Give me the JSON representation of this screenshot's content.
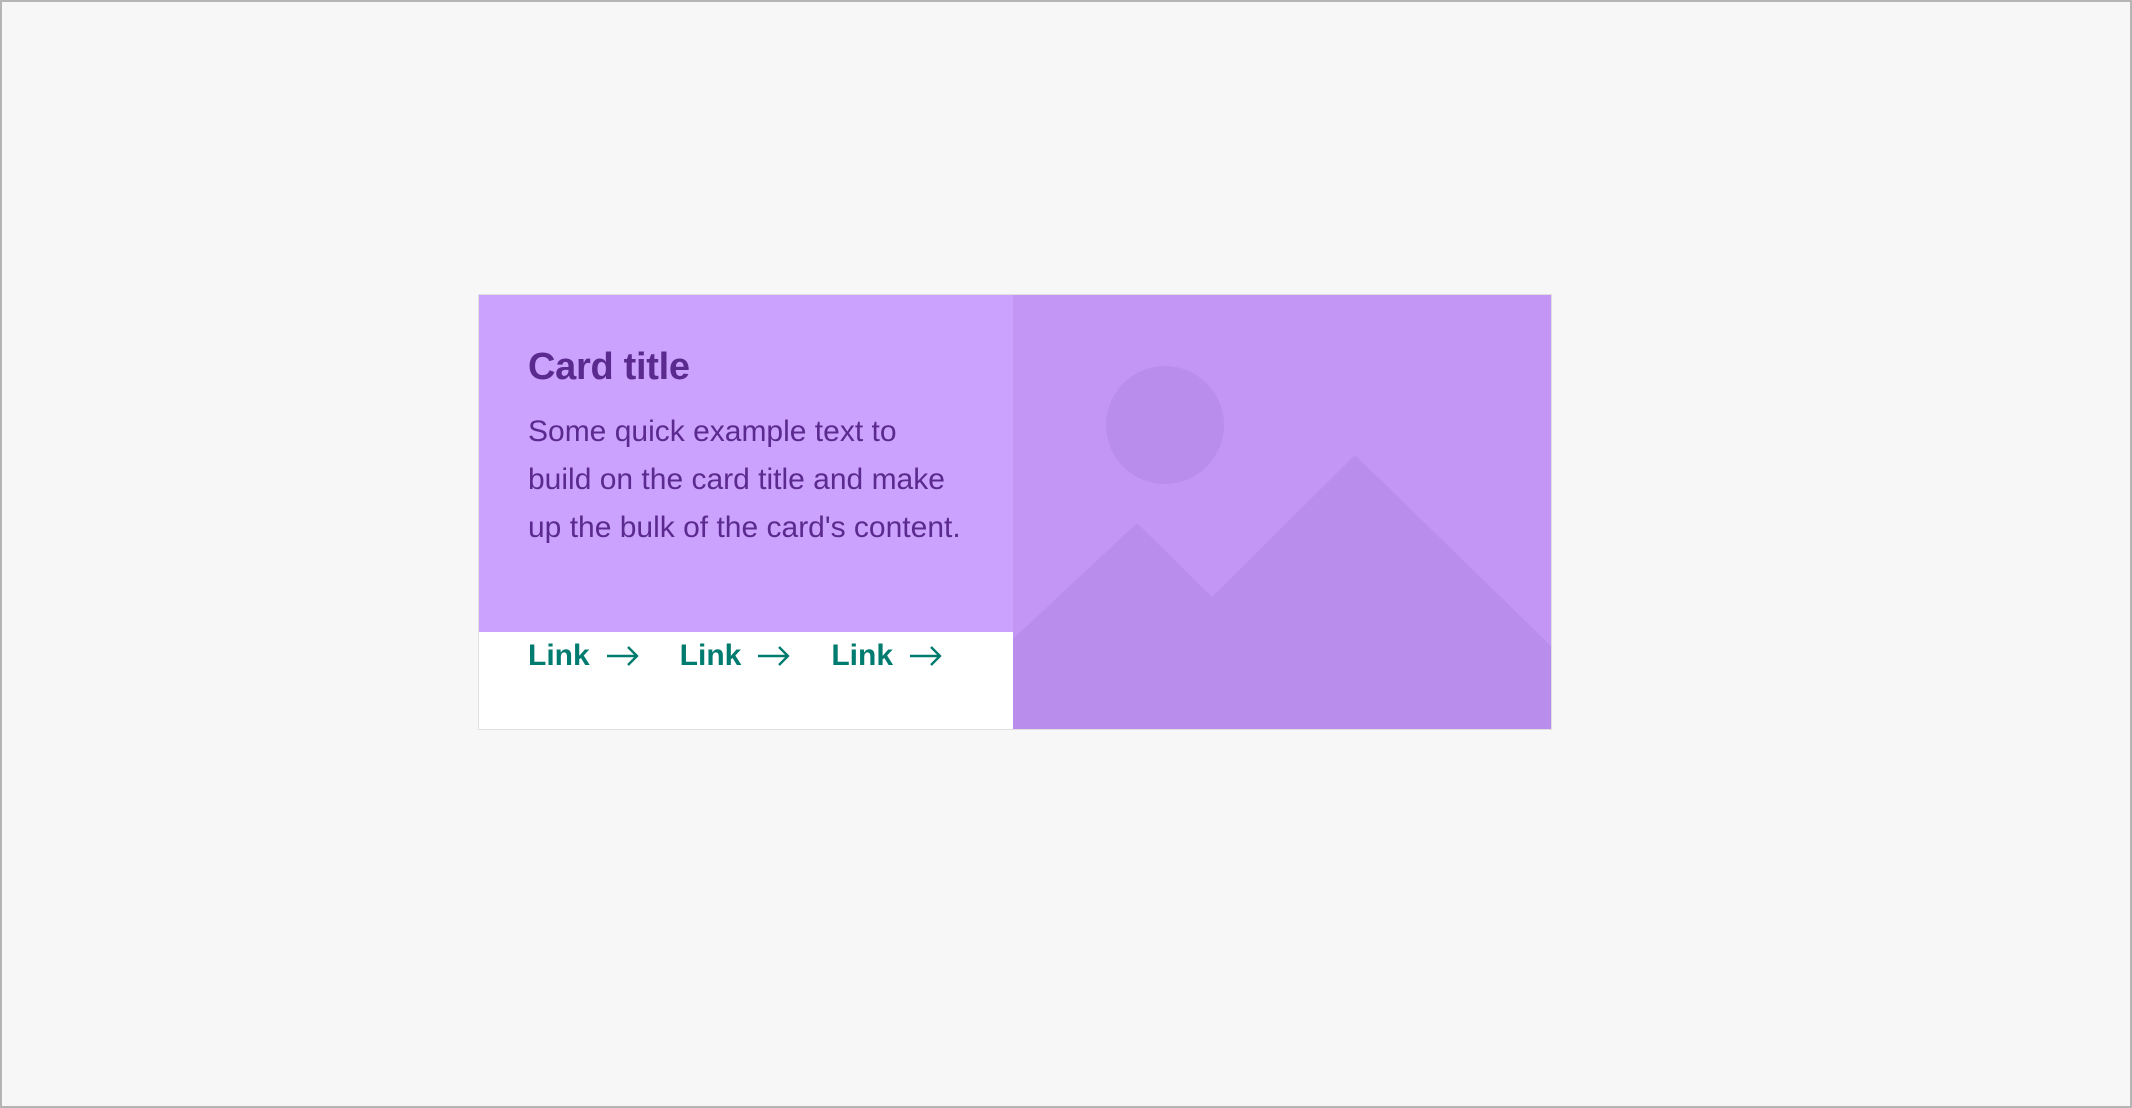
{
  "card": {
    "title": "Card title",
    "text": "Some quick example text to build on the card title and make up the bulk of the card's content.",
    "links": [
      {
        "label": "Link",
        "icon": "arrow-right-icon"
      },
      {
        "label": "Link",
        "icon": "arrow-right-icon"
      },
      {
        "label": "Link",
        "icon": "arrow-right-icon"
      }
    ],
    "media": {
      "icon": "image-placeholder-icon"
    }
  },
  "colors": {
    "page_background": "#f7f7f7",
    "card_body_background": "#cca2ff",
    "card_text": "#5b2a8e",
    "link": "#007b6f",
    "media_background": "#c396f6",
    "media_shapes": "#b88deb"
  }
}
